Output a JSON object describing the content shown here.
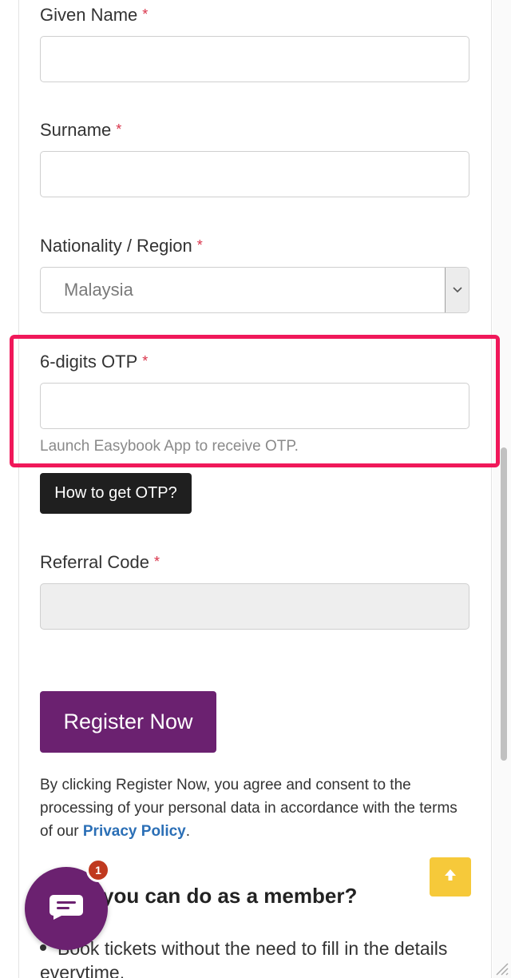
{
  "form": {
    "given_name": {
      "label": "Given Name",
      "required_mark": "*",
      "value": ""
    },
    "surname": {
      "label": "Surname",
      "required_mark": "*",
      "value": ""
    },
    "nationality": {
      "label": "Nationality / Region",
      "required_mark": "*",
      "selected": "Malaysia"
    },
    "otp": {
      "label": "6-digits OTP",
      "required_mark": "*",
      "value": "",
      "hint": "Launch Easybook App to receive OTP."
    },
    "otp_help_button": "How to get OTP?",
    "referral": {
      "label": "Referral Code",
      "required_mark": "*",
      "value": ""
    },
    "register_button": "Register Now"
  },
  "consent": {
    "text_before": "By clicking Register Now, you agree and consent to the processing of your personal data in accordance with the terms of our ",
    "link": "Privacy Policy",
    "text_after": "."
  },
  "member_section": {
    "heading": "you can do as a member?",
    "benefits": [
      "Book tickets without the need to fill in the details everytime."
    ]
  },
  "chat": {
    "badge_count": "1",
    "icon": "chat-bubble-icon"
  },
  "scroll_top": {
    "icon": "arrow-up-icon"
  },
  "colors": {
    "brand_purple": "#6b2170",
    "highlight": "#f0185a",
    "required": "#d9334a",
    "link": "#2b6fb6",
    "scroll_top": "#f6c93a"
  }
}
